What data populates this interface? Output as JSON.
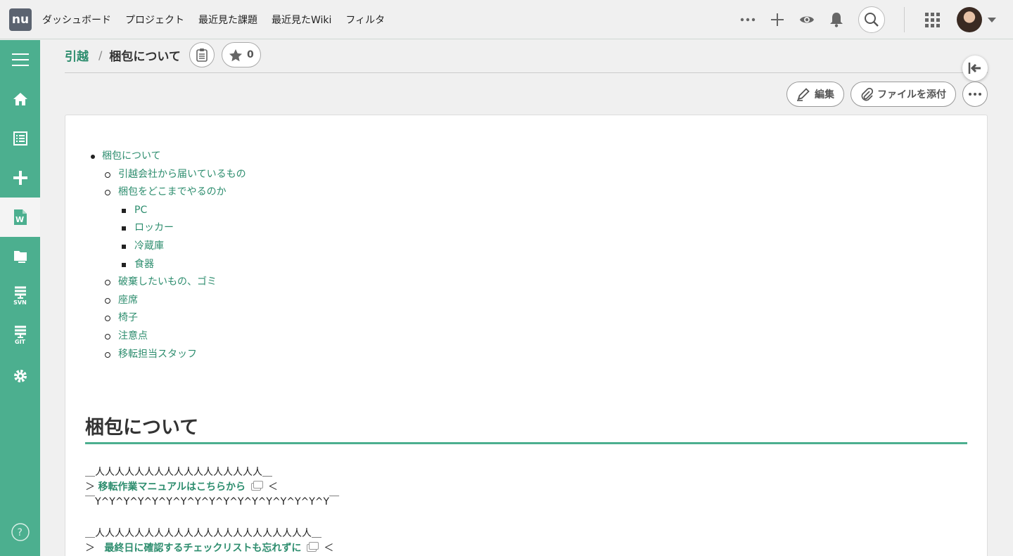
{
  "app": {
    "logo": "nu"
  },
  "topnav": {
    "items": [
      "ダッシュボード",
      "プロジェクト",
      "最近見た課題",
      "最近見たWiki",
      "フィルタ"
    ]
  },
  "toolbar_icons": [
    "more-horizontal-icon",
    "plus-icon",
    "eye-icon",
    "bell-icon",
    "search-icon",
    "apps-grid-icon"
  ],
  "sidebar": {
    "items": [
      {
        "icon": "menu-icon"
      },
      {
        "icon": "home-icon"
      },
      {
        "icon": "list-icon"
      },
      {
        "icon": "plus-icon"
      },
      {
        "icon": "wiki-icon",
        "active": true
      },
      {
        "icon": "folder-icon"
      },
      {
        "icon": "svn-icon",
        "label": "SVN"
      },
      {
        "icon": "git-icon",
        "label": "GIT"
      },
      {
        "icon": "gear-icon"
      },
      {
        "icon": "help-icon"
      }
    ]
  },
  "breadcrumb": {
    "parent": "引越",
    "separator": "/",
    "title": "梱包について",
    "star_count": "0"
  },
  "actions": {
    "edit": "編集",
    "attach": "ファイルを添付"
  },
  "toc": {
    "top": "梱包について",
    "sub": [
      {
        "label": "引越会社から届いているもの"
      },
      {
        "label": "梱包をどこまでやるのか",
        "children": [
          "PC",
          "ロッカー",
          "冷蔵庫",
          "食器"
        ]
      },
      {
        "label": "破棄したいもの、ゴミ"
      },
      {
        "label": "座席"
      },
      {
        "label": "椅子"
      },
      {
        "label": "注意点"
      },
      {
        "label": "移転担当スタッフ"
      }
    ]
  },
  "content": {
    "heading": "梱包について",
    "box1": {
      "top": "＿人人人人人人人人人人人人人人人人人＿",
      "left": "＞",
      "link": "移転作業マニュアルはこちらから",
      "right": "＜",
      "bottom": "￣Y^Y^Y^Y^Y^Y^Y^Y^Y^Y^Y^Y^Y^Y^Y^Y^Y￣"
    },
    "box2": {
      "top": "＿人人人人人人人人人人人人人人人人人人人人人人＿",
      "left": "＞",
      "link": "最終日に確認するチェックリストも忘れずに",
      "right": "＜"
    }
  },
  "colors": {
    "accent": "#4caf8f",
    "link": "#2d8d6e"
  }
}
